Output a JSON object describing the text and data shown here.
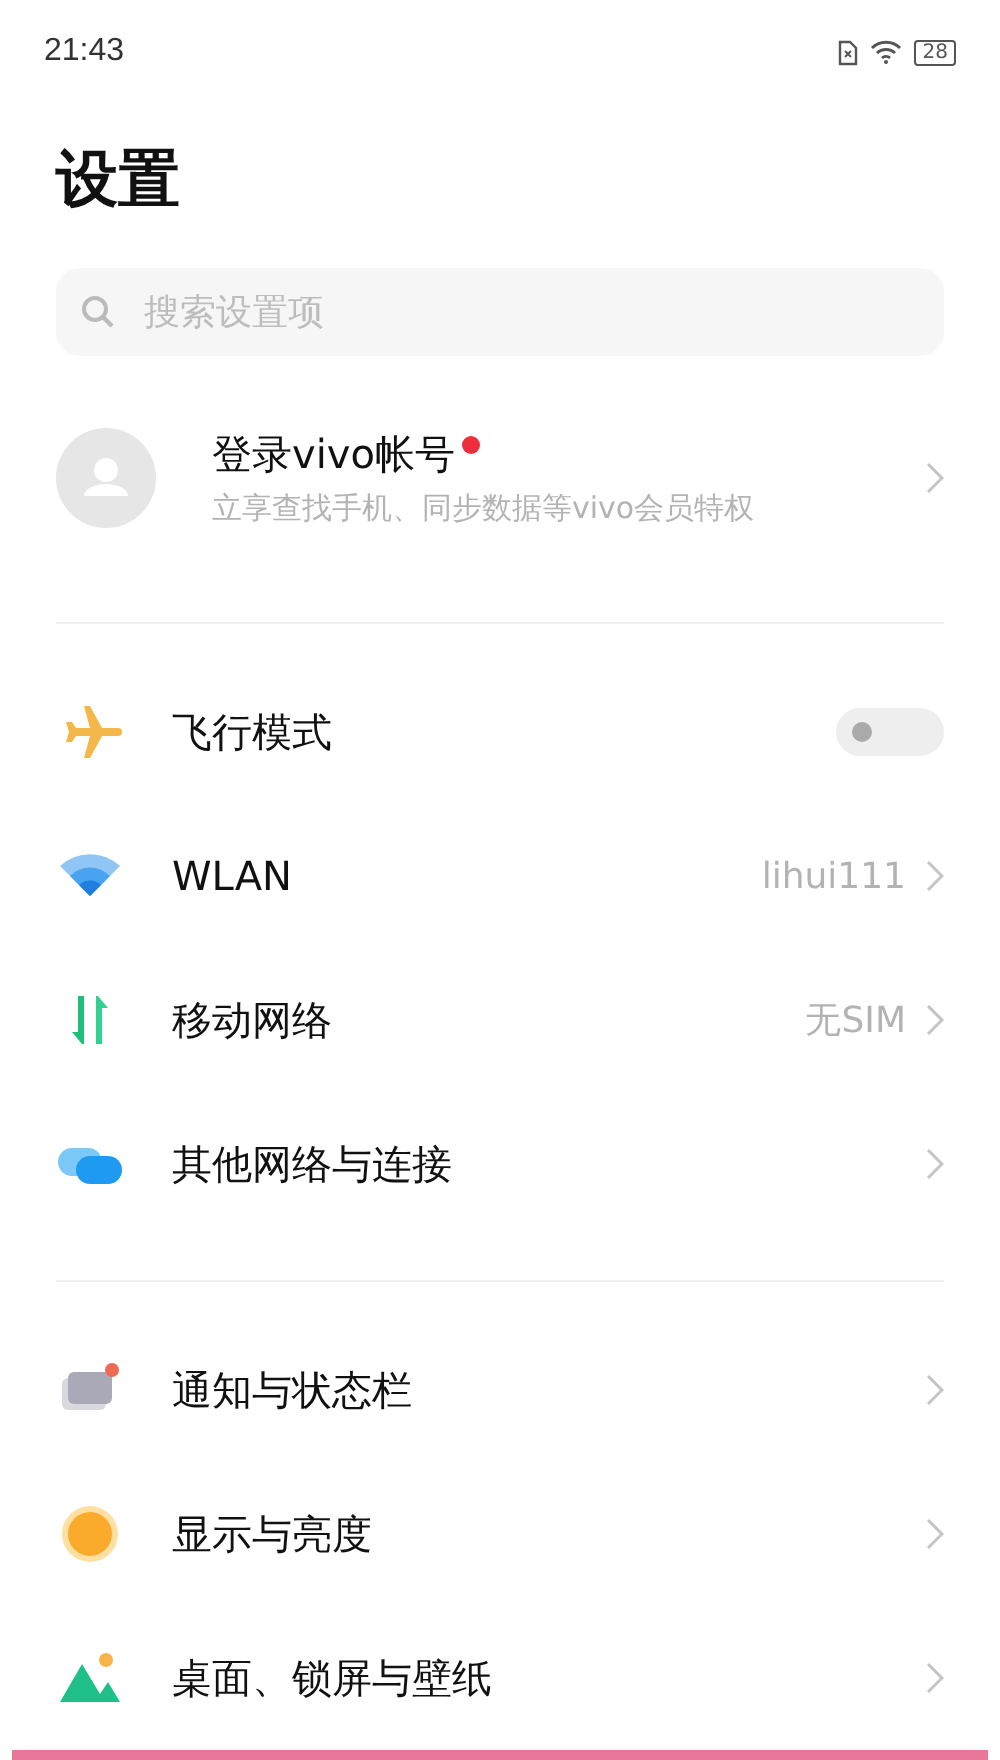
{
  "status_bar": {
    "time": "21:43",
    "battery": "28"
  },
  "title": "设置",
  "search": {
    "placeholder": "搜索设置项"
  },
  "account": {
    "name": "登录vivo帐号",
    "badge": true,
    "subtitle": "立享查找手机、同步数据等vivo会员特权"
  },
  "groups": [
    {
      "items": [
        {
          "kind": "toggle",
          "label": "飞行模式",
          "on": false
        },
        {
          "kind": "link",
          "label": "WLAN",
          "value": "lihui111"
        },
        {
          "kind": "link",
          "label": "移动网络",
          "value": "无SIM"
        },
        {
          "kind": "link",
          "label": "其他网络与连接"
        }
      ]
    },
    {
      "items": [
        {
          "kind": "link",
          "label": "通知与状态栏"
        },
        {
          "kind": "link",
          "label": "显示与亮度"
        },
        {
          "kind": "link",
          "label": "桌面、锁屏与壁纸"
        }
      ]
    }
  ]
}
